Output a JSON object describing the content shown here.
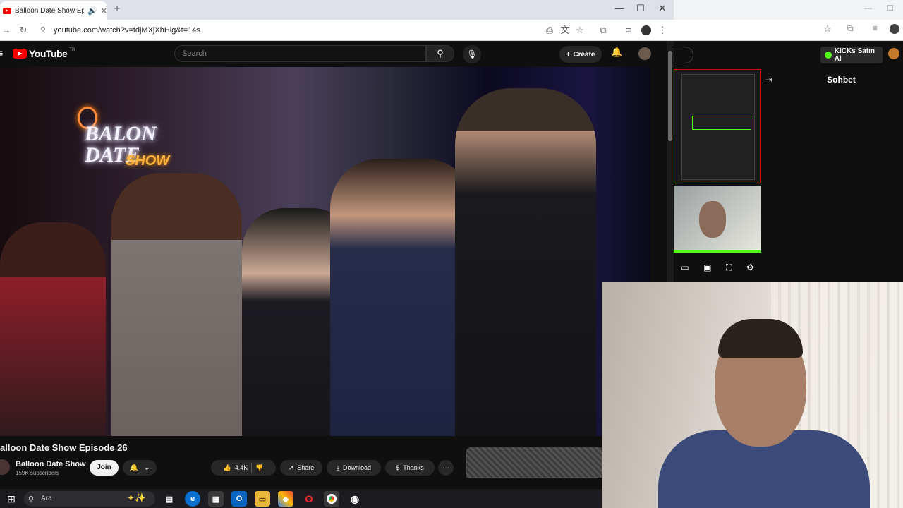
{
  "browser": {
    "tab_title": "Balloon Date Show Episode",
    "tab_audio_icon": "speaker-icon",
    "url": "youtube.com/watch?v=tdjMXjXhHlg&t=14s"
  },
  "youtube": {
    "logo_text": "YouTube",
    "logo_region": "TR",
    "search_placeholder": "Search",
    "create_label": "Create",
    "video_title": "alloon Date Show Episode 26",
    "neon_sign": "BALON DATE",
    "neon_sign_sub": "SHOW",
    "channel_name": "Balloon Date Show",
    "channel_subs": "159K subscribers",
    "join_label": "Join",
    "likes": "4.4K",
    "share_label": "Share",
    "download_label": "Download",
    "thanks_label": "Thanks"
  },
  "side_panel": {
    "kick_label": "KICKs Satın Al",
    "chat_title": "Sohbet"
  },
  "taskbar": {
    "search_placeholder": "Ara"
  },
  "colors": {
    "youtube_red": "#ff0000",
    "kick_green": "#53fc18",
    "yt_bg": "#0f0f0f"
  }
}
